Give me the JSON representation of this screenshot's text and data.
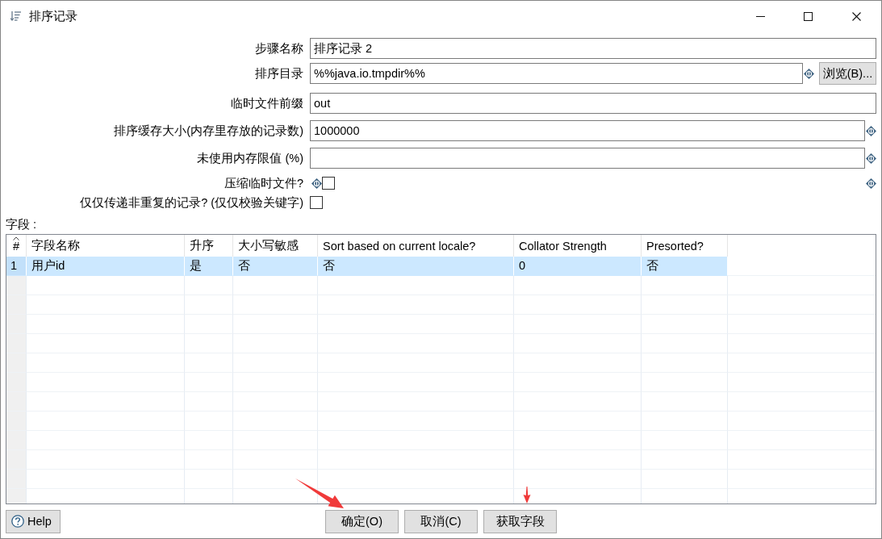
{
  "window": {
    "title": "排序记录"
  },
  "form": {
    "rows": [
      {
        "kind": "text",
        "label": "步骤名称",
        "value": "排序记录 2",
        "variable": false
      },
      {
        "kind": "text",
        "label": "排序目录",
        "value": "%%java.io.tmpdir%%",
        "variable": true,
        "button": "浏览(B)..."
      },
      {
        "kind": "text",
        "label": "临时文件前缀",
        "value": "out",
        "variable": false
      },
      {
        "kind": "text",
        "label": "排序缓存大小(内存里存放的记录数)",
        "value": "1000000",
        "variable": true
      },
      {
        "kind": "text",
        "label": "未使用内存限值 (%)",
        "variable": true
      },
      {
        "kind": "checkbox",
        "label": "压缩临时文件?",
        "checked": false,
        "variable": true,
        "trailing_variable": true
      },
      {
        "kind": "checkbox",
        "label": "仅仅传递非重复的记录? (仅仅校验关键字)",
        "checked": false,
        "variable": false,
        "trailing_variable": false
      }
    ]
  },
  "fields_section": {
    "label": "字段 :",
    "table": {
      "columns": [
        {
          "label": "#",
          "sorted": true
        },
        {
          "label": "字段名称",
          "sorted": false
        },
        {
          "label": "升序",
          "sorted": false
        },
        {
          "label": "大小写敏感",
          "sorted": false
        },
        {
          "label": "Sort based on current locale?",
          "sorted": false
        },
        {
          "label": "Collator Strength",
          "sorted": false
        },
        {
          "label": "Presorted?",
          "sorted": false
        }
      ],
      "rows": [
        {
          "selected": true,
          "cells": [
            "1",
            "用户id",
            "是",
            "否",
            "否",
            "0",
            "否"
          ]
        }
      ]
    }
  },
  "footer": {
    "help": {
      "label": "Help"
    },
    "buttons": [
      {
        "label": "确定(O)"
      },
      {
        "label": "取消(C)"
      },
      {
        "label": "获取字段"
      }
    ]
  }
}
